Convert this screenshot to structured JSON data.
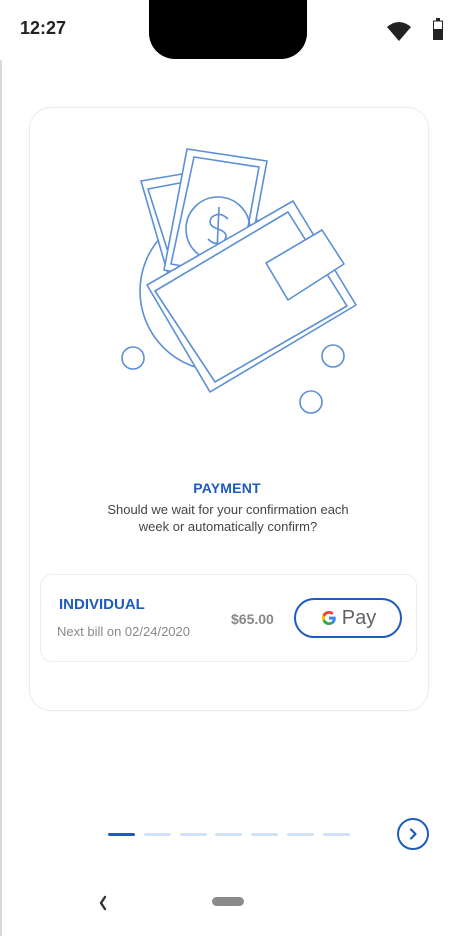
{
  "status_bar": {
    "time": "12:27",
    "icons": [
      "wifi-icon",
      "battery-icon"
    ]
  },
  "onboarding": {
    "illustration": "wallet-with-money-illustration",
    "title": "PAYMENT",
    "description": "Should we wait for your confirmation each week or automatically confirm?"
  },
  "plan": {
    "name": "INDIVIDUAL",
    "next_bill": "Next bill on 02/24/2020",
    "price": "$65.00",
    "pay_label": "Pay"
  },
  "pager": {
    "count": 7,
    "active_index": 0
  },
  "colors": {
    "accent": "#1e5bbf",
    "pager_inactive": "#d2e1f3",
    "muted": "#888888"
  }
}
